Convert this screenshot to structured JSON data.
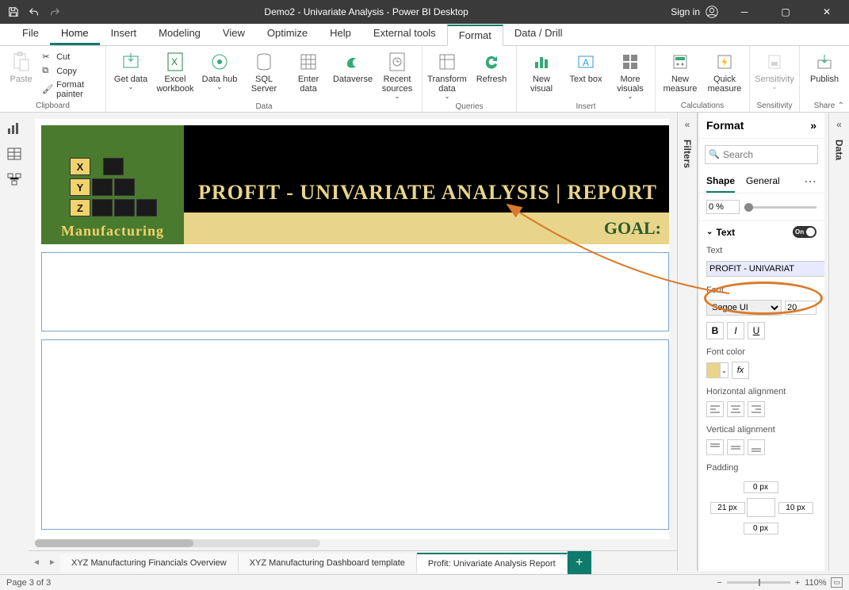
{
  "titlebar": {
    "title": "Demo2 - Univariate Analysis - Power BI Desktop",
    "signin": "Sign in"
  },
  "menutabs": [
    "File",
    "Home",
    "Insert",
    "Modeling",
    "View",
    "Optimize",
    "Help",
    "External tools",
    "Format",
    "Data / Drill"
  ],
  "ribbon": {
    "clipboard": {
      "paste": "Paste",
      "cut": "Cut",
      "copy": "Copy",
      "painter": "Format painter",
      "label": "Clipboard"
    },
    "data": {
      "get": "Get data",
      "excel": "Excel workbook",
      "hub": "Data hub",
      "sql": "SQL Server",
      "enter": "Enter data",
      "dv": "Dataverse",
      "recent": "Recent sources",
      "label": "Data"
    },
    "queries": {
      "transform": "Transform data",
      "refresh": "Refresh",
      "label": "Queries"
    },
    "insert": {
      "newv": "New visual",
      "textbox": "Text box",
      "more": "More visuals",
      "label": "Insert"
    },
    "calc": {
      "newm": "New measure",
      "quick": "Quick measure",
      "label": "Calculations"
    },
    "sens": {
      "btn": "Sensitivity",
      "label": "Sensitivity"
    },
    "share": {
      "btn": "Publish",
      "label": "Share"
    }
  },
  "canvas": {
    "logo_letters": [
      "X",
      "Y",
      "Z"
    ],
    "manufacturing": "Manufacturing",
    "title": "PROFIT - UNIVARIATE ANALYSIS | REPORT",
    "goal": "GOAL:"
  },
  "pagetabs": {
    "tabs": [
      "XYZ Manufacturing Financials Overview",
      "XYZ Manufacturing Dashboard template",
      "Profit: Univariate Analysis Report"
    ]
  },
  "statusbar": {
    "page": "Page 3 of 3",
    "zoom": "110%"
  },
  "filters": {
    "label": "Filters"
  },
  "datapane": {
    "label": "Data"
  },
  "format": {
    "title": "Format",
    "search_ph": "Search",
    "tab_shape": "Shape",
    "tab_general": "General",
    "rotation_val": "0 %",
    "text_card": "Text",
    "text_toggle": "On",
    "text_label": "Text",
    "text_value": "PROFIT - UNIVARIAT",
    "font_label": "Font",
    "font_family": "Segoe UI",
    "font_size": "20",
    "fontcolor_label": "Font color",
    "halign_label": "Horizontal alignment",
    "valign_label": "Vertical alignment",
    "padding_label": "Padding",
    "pad_top": "0 px",
    "pad_left": "21 px",
    "pad_right": "10 px",
    "pad_bottom": "0 px"
  }
}
